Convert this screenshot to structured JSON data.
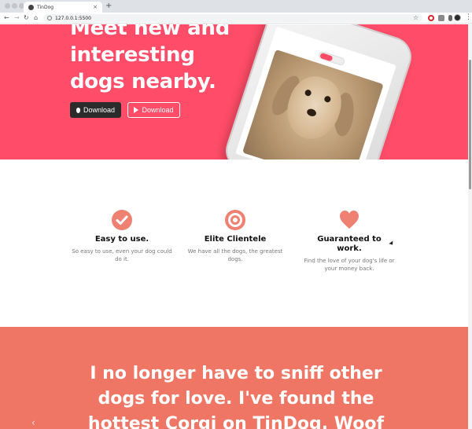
{
  "browser": {
    "tab_title": "TinDog",
    "tab_close": "×",
    "new_tab": "+",
    "url": "127.0.0.1:5500",
    "icons": {
      "back": "←",
      "forward": "→",
      "reload": "↻",
      "home": "⌂",
      "star": "☆",
      "menu": "⋮"
    }
  },
  "hero": {
    "title": "Meet new and interesting dogs nearby.",
    "download_apple": "Download",
    "download_google": "Download"
  },
  "features": [
    {
      "title": "Easy to use.",
      "text": "So easy to use, even your dog could do it."
    },
    {
      "title": "Elite Clientele",
      "text": "We have all the dogs, the greatest dogs."
    },
    {
      "title": "Guaranteed to work.",
      "text": "Find the love of your dog's life or your money back."
    }
  ],
  "testimonial": {
    "quote": "I no longer have to sniff other dogs for love. I've found the hottest Corgi on TinDog. Woof"
  },
  "colors": {
    "hero_bg": "#ff4c68",
    "testimonial_bg": "#ef7665",
    "icon_accent": "#ef8172"
  }
}
